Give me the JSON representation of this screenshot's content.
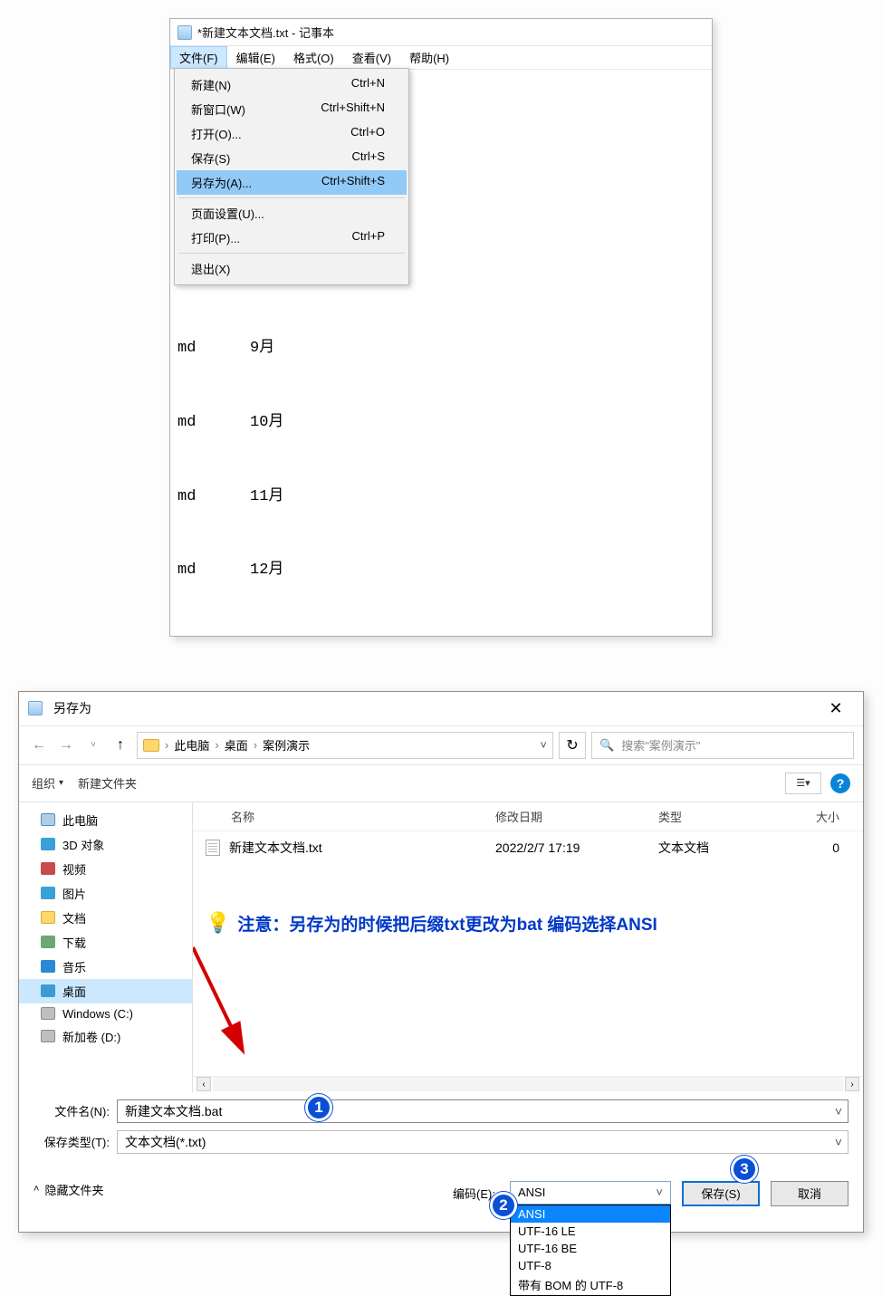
{
  "notepad": {
    "title": "*新建文本文档.txt - 记事本",
    "menubar": {
      "file": "文件(F)",
      "edit": "编辑(E)",
      "format": "格式(O)",
      "view": "查看(V)",
      "help": "帮助(H)"
    },
    "filemenu": {
      "new": {
        "label": "新建(N)",
        "shortcut": "Ctrl+N"
      },
      "newwin": {
        "label": "新窗口(W)",
        "shortcut": "Ctrl+Shift+N"
      },
      "open": {
        "label": "打开(O)...",
        "shortcut": "Ctrl+O"
      },
      "save": {
        "label": "保存(S)",
        "shortcut": "Ctrl+S"
      },
      "saveas": {
        "label": "另存为(A)...",
        "shortcut": "Ctrl+Shift+S"
      },
      "pagesetup": {
        "label": "页面设置(U)...",
        "shortcut": ""
      },
      "print": {
        "label": "打印(P)...",
        "shortcut": "Ctrl+P"
      },
      "exit": {
        "label": "退出(X)",
        "shortcut": ""
      }
    },
    "editor_rows": [
      {
        "cmd": "md",
        "val": "9月"
      },
      {
        "cmd": "md",
        "val": "10月"
      },
      {
        "cmd": "md",
        "val": "11月"
      },
      {
        "cmd": "md",
        "val": "12月"
      }
    ]
  },
  "saveas": {
    "title": "另存为",
    "breadcrumb": {
      "root": "此电脑",
      "desktop": "桌面",
      "folder": "案例演示"
    },
    "search_placeholder": "搜索\"案例演示\"",
    "organize": "组织",
    "newfolder": "新建文件夹",
    "tree": {
      "pc": "此电脑",
      "obj3d": "3D 对象",
      "video": "视频",
      "pictures": "图片",
      "docs": "文档",
      "downloads": "下载",
      "music": "音乐",
      "desktop": "桌面",
      "cdrive": "Windows (C:)",
      "ddrive": "新加卷 (D:)"
    },
    "columns": {
      "name": "名称",
      "date": "修改日期",
      "type": "类型",
      "size": "大小"
    },
    "files": [
      {
        "name": "新建文本文档.txt",
        "date": "2022/2/7 17:19",
        "type": "文本文档",
        "size": "0"
      }
    ],
    "annotation": "注意：另存为的时候把后缀txt更改为bat  编码选择ANSI",
    "filename_label": "文件名(N):",
    "filename_value": "新建文本文档.bat",
    "filetype_label": "保存类型(T):",
    "filetype_value": "文本文档(*.txt)",
    "hide_folders": "隐藏文件夹",
    "encoding_label": "编码(E):",
    "encoding_value": "ANSI",
    "encoding_options": [
      "ANSI",
      "UTF-16 LE",
      "UTF-16 BE",
      "UTF-8",
      "带有 BOM 的 UTF-8"
    ],
    "save_btn": "保存(S)",
    "cancel_btn": "取消",
    "badges": {
      "b1": "1",
      "b2": "2",
      "b3": "3"
    }
  }
}
